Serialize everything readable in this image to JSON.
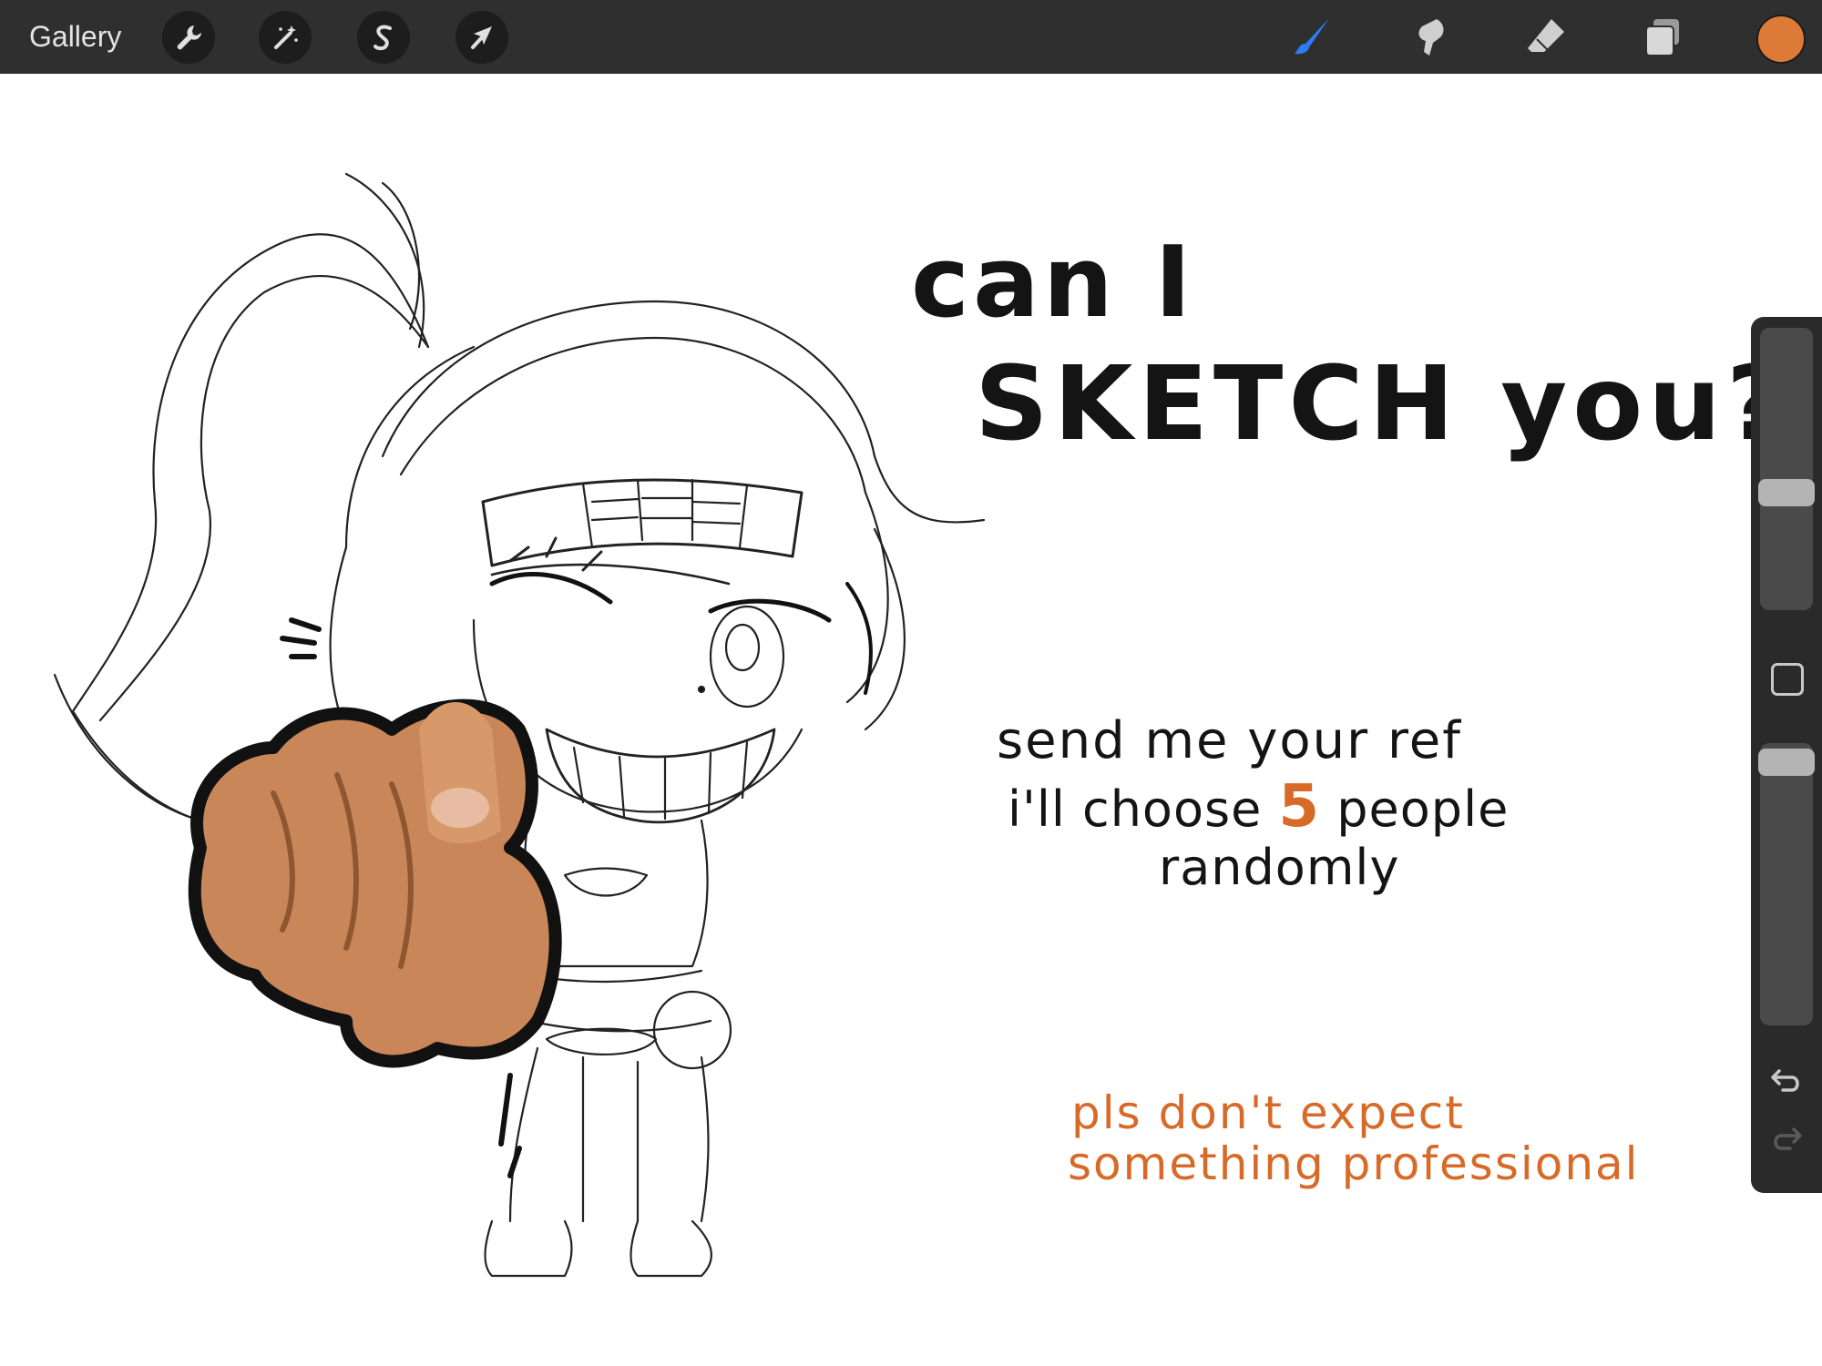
{
  "toolbar": {
    "gallery_label": "Gallery",
    "left_tools": [
      {
        "name": "actions",
        "icon": "wrench-icon"
      },
      {
        "name": "adjustments",
        "icon": "magic-wand-icon"
      },
      {
        "name": "selection",
        "icon": "selection-s-icon"
      },
      {
        "name": "transform",
        "icon": "arrow-cursor-icon"
      }
    ],
    "right_tools": [
      {
        "name": "brush",
        "icon": "brush-icon",
        "active": true
      },
      {
        "name": "smudge",
        "icon": "smudge-icon"
      },
      {
        "name": "eraser",
        "icon": "eraser-icon"
      },
      {
        "name": "layers",
        "icon": "layers-icon"
      }
    ],
    "current_color": "#DE7A37"
  },
  "canvas": {
    "title_line1": "can I",
    "title_line2": "SKETCH you?",
    "body_line1": "send me your ref",
    "body_line2_prefix": "i'll choose",
    "body_line2_number": "5",
    "body_line2_suffix": "people",
    "body_line3": "randomly",
    "note_line1": "pls don't expect",
    "note_line2": "something professional",
    "accent_color": "#D86A28",
    "ink_color": "#141414"
  },
  "sidebar": {
    "brush_size_level": 0.6,
    "brush_opacity_level": 0.93,
    "icons": [
      "modify-square-icon",
      "undo-icon",
      "redo-icon"
    ]
  },
  "colors": {
    "toolbar_bg": "#2F2F2F",
    "active_tool": "#2E7CF6",
    "inactive_tool": "#CFCFCF",
    "sidebar_bg": "#2A2A2A"
  }
}
